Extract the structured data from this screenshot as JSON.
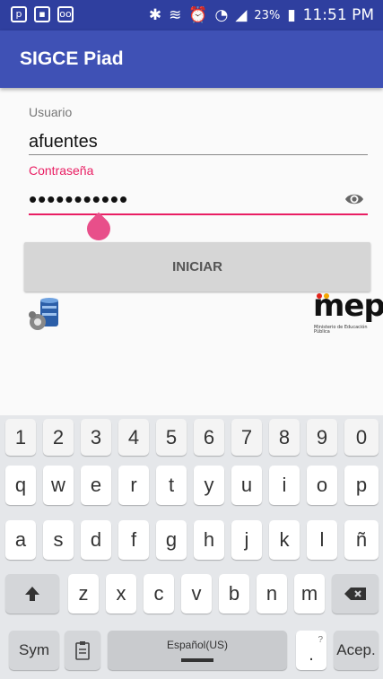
{
  "status_bar": {
    "left_icons": [
      "notification-icon",
      "image-icon",
      "voicemail-icon"
    ],
    "right_icons": [
      "bluetooth-icon",
      "mute-icon",
      "alarm-icon",
      "wifi-icon",
      "signal-icon",
      "battery-icon"
    ],
    "battery": "23%",
    "time": "11:51 PM"
  },
  "app_bar": {
    "title": "SIGCE Piad"
  },
  "form": {
    "user_label": "Usuario",
    "user_value": "afuentes",
    "password_label": "Contraseña",
    "password_value": "•••••••••••",
    "login_button": "INICIAR"
  },
  "logos": {
    "mep_word": "mep",
    "mep_sub": "Ministerio de Educación Pública"
  },
  "keyboard": {
    "number_row": [
      "1",
      "2",
      "3",
      "4",
      "5",
      "6",
      "7",
      "8",
      "9",
      "0"
    ],
    "row1": [
      "q",
      "w",
      "e",
      "r",
      "t",
      "y",
      "u",
      "i",
      "o",
      "p"
    ],
    "row2": [
      "a",
      "s",
      "d",
      "f",
      "g",
      "h",
      "j",
      "k",
      "l",
      "ñ"
    ],
    "row3": [
      "z",
      "x",
      "c",
      "v",
      "b",
      "n",
      "m"
    ],
    "sym": "Sym",
    "space_label": "Español(US)",
    "punct": ".",
    "punct_hint": "?",
    "enter": "Acep."
  },
  "colors": {
    "primary": "#3f51b5",
    "status": "#2f3f9f",
    "accent": "#e91e63"
  }
}
